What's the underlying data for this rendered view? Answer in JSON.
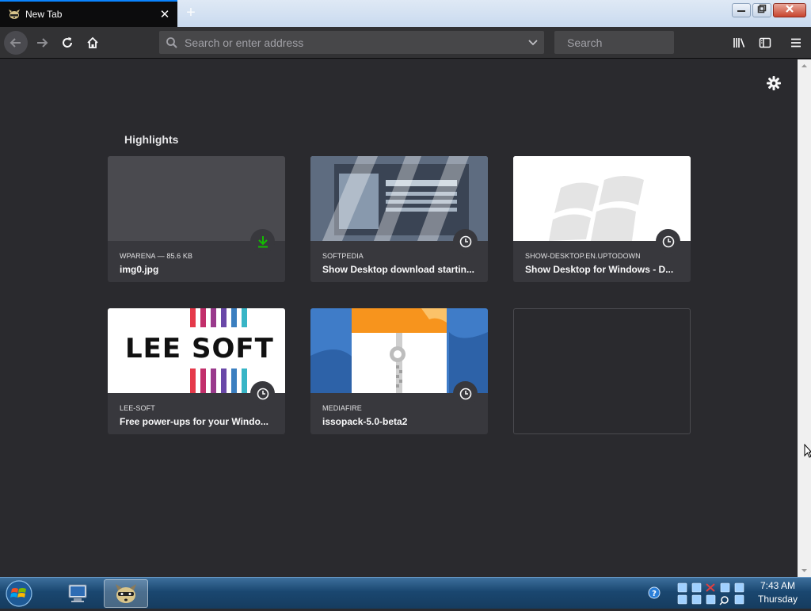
{
  "window": {
    "tab_title": "New Tab",
    "close_tab_glyph": "✕",
    "new_tab_glyph": "+"
  },
  "toolbar": {
    "url_placeholder": "Search or enter address",
    "search_placeholder": "Search"
  },
  "highlights": {
    "title": "Highlights",
    "cards": [
      {
        "source": "WPARENA — 85.6 KB",
        "title": "img0.jpg",
        "type_icon": "download-icon"
      },
      {
        "source": "SOFTPEDIA",
        "title": "Show Desktop download startin...",
        "type_icon": "clock-icon"
      },
      {
        "source": "SHOW-DESKTOP.EN.UPTODOWN",
        "title": "Show Desktop for Windows - D...",
        "type_icon": "clock-icon"
      },
      {
        "source": "LEE-SOFT",
        "title": "Free power-ups for your Windo...",
        "type_icon": "clock-icon",
        "thumb_text": "LEE SOFT"
      },
      {
        "source": "MEDIAFIRE",
        "title": "issopack-5.0-beta2",
        "type_icon": "clock-icon"
      }
    ]
  },
  "taskbar": {
    "time": "7:43 AM",
    "day": "Thursday"
  },
  "colors": {
    "page_background": "#2a2a2e",
    "card_background": "#38383d",
    "download_green": "#12bc00",
    "tab_accent": "#0a84ff"
  }
}
